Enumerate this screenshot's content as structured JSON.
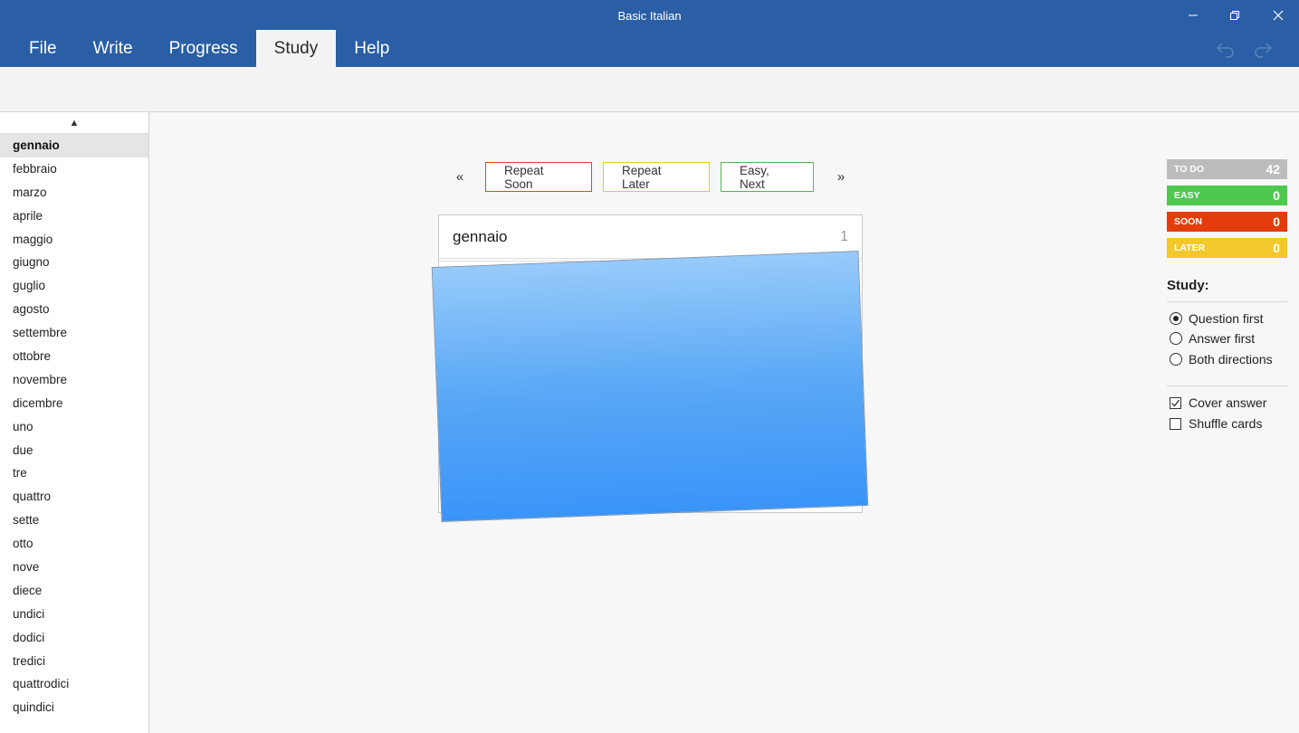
{
  "window": {
    "title": "Basic Italian"
  },
  "menu": {
    "items": [
      {
        "label": "File"
      },
      {
        "label": "Write"
      },
      {
        "label": "Progress"
      },
      {
        "label": "Study"
      },
      {
        "label": "Help"
      }
    ],
    "active": "Study"
  },
  "sidebar": {
    "scroll_up_glyph": "▲",
    "selected": "gennaio",
    "words": [
      "gennaio",
      "febbraio",
      "marzo",
      "aprile",
      "maggio",
      "giugno",
      "guglio",
      "agosto",
      "settembre",
      "ottobre",
      "novembre",
      "dicembre",
      "uno",
      "due",
      "tre",
      "quattro",
      "sette",
      "otto",
      "nove",
      "diece",
      "undici",
      "dodici",
      "tredici",
      "quattrodici",
      "quindici"
    ]
  },
  "study": {
    "prev_glyph": "«",
    "next_glyph": "»",
    "buttons": {
      "repeat_soon": "Repeat Soon",
      "repeat_later": "Repeat Later",
      "easy_next": "Easy, Next"
    },
    "card": {
      "word": "gennaio",
      "number": "1"
    }
  },
  "stats": [
    {
      "label": "TO DO",
      "value": "42",
      "color": "#bcbcbc"
    },
    {
      "label": "EASY",
      "value": "0",
      "color": "#4ec94e"
    },
    {
      "label": "SOON",
      "value": "0",
      "color": "#e33d0e"
    },
    {
      "label": "LATER",
      "value": "0",
      "color": "#f2c82a"
    }
  ],
  "options": {
    "title": "Study:",
    "radios": [
      {
        "label": "Question first",
        "checked": true
      },
      {
        "label": "Answer first",
        "checked": false
      },
      {
        "label": "Both directions",
        "checked": false
      }
    ],
    "checkboxes": [
      {
        "label": "Cover answer",
        "checked": true
      },
      {
        "label": "Shuffle cards",
        "checked": false
      }
    ]
  },
  "colors": {
    "titlebar": "#2a5ea5",
    "card_cover_top": "#97cbfa",
    "card_cover_bottom": "#3a94f8"
  }
}
